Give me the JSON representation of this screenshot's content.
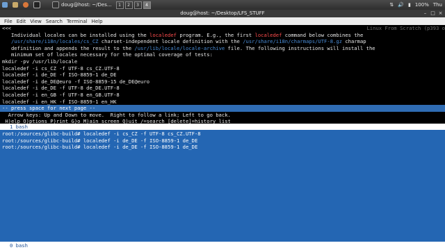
{
  "panel": {
    "apps_label": "Applications",
    "places_label": "Places",
    "tasks": [
      "doug@host: ~/Des..."
    ],
    "workspaces": [
      "1",
      "2",
      "3",
      "4"
    ],
    "battery": "100%",
    "clock": "Thu"
  },
  "window": {
    "title": "doug@host: ~/Desktop/LFS_STUFF",
    "menu": [
      "File",
      "Edit",
      "View",
      "Search",
      "Terminal",
      "Help"
    ]
  },
  "term": {
    "first_row": "<<<",
    "header_right": "Linux From Scratch (p393 o",
    "line1_a": "   Individual locales can be installed using the ",
    "line1_hl": "localedef",
    "line1_b": " program. E.g., the first ",
    "line1_hl2": "localedef",
    "line1_c": " command below combines the",
    "line2_a": "   ",
    "line2_path": "/usr/share/i18n/locales/cs_CZ",
    "line2_b": " charset-independent locale definition with the ",
    "line2_path2": "/usr/share/i18n/charmaps/UTF-8.gz",
    "line2_c": " charmap",
    "line3_a": "   definition and appends the result to the ",
    "line3_path": "/usr/lib/locale/locale-archive",
    "line3_b": " file. The following instructions will install the",
    "line4": "   minimum set of locales necessary for the optimal coverage of tests:",
    "cmds": [
      "mkdir -pv /usr/lib/locale",
      "localedef -i cs_CZ -f UTF-8 cs_CZ.UTF-8",
      "localedef -i de_DE -f ISO-8859-1 de_DE",
      "localedef -i de_DE@euro -f ISO-8859-15 de_DE@euro",
      "localedef -i de_DE -f UTF-8 de_DE.UTF-8",
      "localedef -i en_GB -f UTF-8 en_GB.UTF-8",
      "localedef -i en_HK -f ISO-8859-1 en_HK"
    ],
    "status": "-- press space for next page --",
    "help1": "  Arrow keys: Up and Down to move.  Right to follow a link; Left to go back.",
    "help2": " H)elp O)ptions P)rint G)o M)ain screen Q)uit /=search [delete]=history list",
    "tab_top": "1 bash",
    "shell_lines": [
      "root:/sources/glibc-build# localedef -i cs_CZ -f UTF-8 cs_CZ.UTF-8",
      "root:/sources/glibc-build# localedef -i de_DE -f ISO-8859-1 de_DE",
      "root:/sources/glibc-build# localedef -i de_DE -f ISO-8859-1 de_DE"
    ],
    "tab_bottom": "0 bash"
  }
}
